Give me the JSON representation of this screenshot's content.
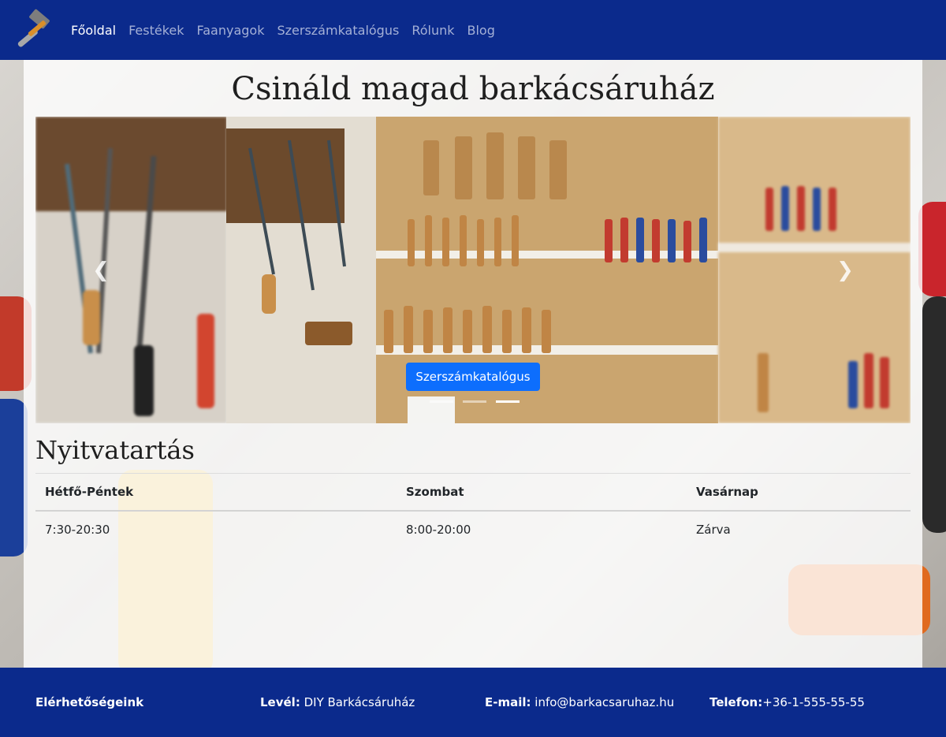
{
  "nav": {
    "items": [
      {
        "label": "Főoldal",
        "active": true
      },
      {
        "label": "Festékek",
        "active": false
      },
      {
        "label": "Faanyagok",
        "active": false
      },
      {
        "label": "Szerszámkatalógus",
        "active": false
      },
      {
        "label": "Rólunk",
        "active": false
      },
      {
        "label": "Blog",
        "active": false
      }
    ],
    "logo_icon": "hammer-icon"
  },
  "main": {
    "title": "Csináld magad barkácsáruház"
  },
  "carousel": {
    "button_label": "Szerszámkatalógus",
    "prev_icon": "chevron-left-icon",
    "next_icon": "chevron-right-icon",
    "indicator_count": 3,
    "active_indicator": 2
  },
  "hours": {
    "title": "Nyitvatartás",
    "headers": [
      "Hétfő-Péntek",
      "Szombat",
      "Vasárnap"
    ],
    "values": [
      "7:30-20:30",
      "8:00-20:00",
      "Zárva"
    ]
  },
  "footer": {
    "heading": "Elérhetőségeink",
    "mail_label": "Levél:",
    "mail_value": "DIY Barkácsáruház",
    "email_label": "E-mail:",
    "email_value": "info@barkacsaruhaz.hu",
    "phone_label": "Telefon:",
    "phone_value": "+36-1-555-55-55"
  },
  "colors": {
    "navbar": "#0b2a8c",
    "accent": "#0d6efd"
  }
}
